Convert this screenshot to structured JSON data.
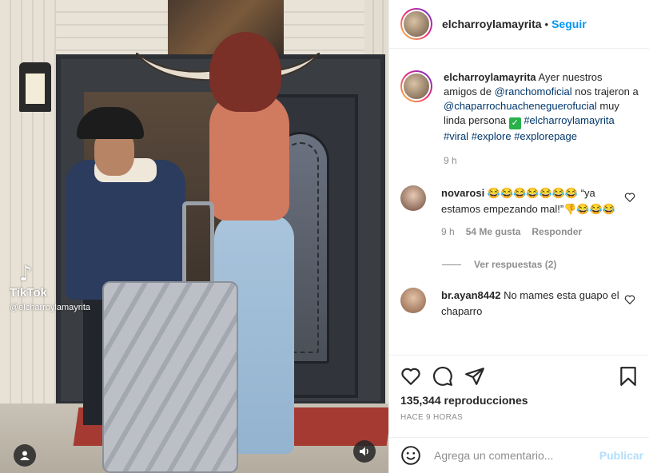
{
  "post": {
    "username": "elcharroylamayrita",
    "follow_label": "Seguir",
    "dot": "•"
  },
  "video": {
    "watermark_word": "TikTok",
    "watermark_handle": "@elcharroylamayrita",
    "watermark_logo": "♪"
  },
  "caption": {
    "username": "elcharroylamayrita",
    "text_1": "Ayer nuestros amigos de",
    "mention_1": "@ranchomoficial",
    "text_2": "nos trajeron a",
    "mention_2": "@chaparrochuacheneguerofucial",
    "text_3": "muy linda persona",
    "check": "✓",
    "hashtags": [
      "#elcharroylamayrita",
      "#viral",
      "#explore",
      "#explorepage"
    ],
    "time": "9 h"
  },
  "comments": [
    {
      "username": "novarosi",
      "text": "😂😂😂😂😂😂😂 “ya estamos empezando mal!”👎😂😂😂",
      "time": "9 h",
      "likes": "54 Me gusta",
      "reply_label": "Responder",
      "view_replies": "Ver respuestas (2)"
    },
    {
      "username": "br.ayan8442",
      "text": "No mames esta guapo el chaparro"
    }
  ],
  "actions": {
    "views": "135,344 reproducciones",
    "posted": "HACE 9 HORAS"
  },
  "add_comment": {
    "placeholder": "Agrega un comentario...",
    "post_label": "Publicar"
  },
  "colors": {
    "accent": "#0095f6",
    "link": "#00376b",
    "muted": "#8e8e8e"
  },
  "icons": [
    "heart-icon",
    "comment-icon",
    "share-icon",
    "bookmark-icon",
    "emoji-icon",
    "user-tag-icon",
    "volume-icon"
  ]
}
